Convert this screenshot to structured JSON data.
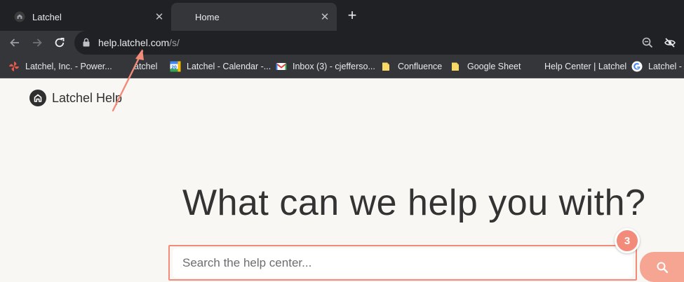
{
  "browser": {
    "tabs": [
      {
        "title": "Latchel",
        "close": "✕"
      },
      {
        "title": "Home",
        "close": "✕"
      }
    ],
    "new_tab": "+",
    "url": {
      "host": "help.latchel.com",
      "path": "/s/"
    },
    "bookmarks": [
      {
        "label": "Latchel, Inc. - Power...",
        "icon": "pinwheel-icon"
      },
      {
        "label": "atchel",
        "icon": "none"
      },
      {
        "label": "Latchel - Calendar -...",
        "icon": "google-calendar-icon"
      },
      {
        "label": "Inbox (3) - cjefferso...",
        "icon": "gmail-icon"
      },
      {
        "label": "Confluence",
        "icon": "folder-icon"
      },
      {
        "label": "Google Sheet",
        "icon": "folder-icon"
      },
      {
        "label": "Help Center | Latchel",
        "icon": "none"
      },
      {
        "label": "Latchel - A",
        "icon": "google-icon"
      }
    ]
  },
  "page": {
    "logo_text": "Latchel Help",
    "headline": "What can we help you with?",
    "search": {
      "placeholder": "Search the help center...",
      "value": ""
    },
    "step_badge": "3"
  },
  "colors": {
    "accent": "#f28b7a",
    "search_button": "#f6a592",
    "page_bg": "#f8f7f3",
    "headline": "#333333"
  }
}
